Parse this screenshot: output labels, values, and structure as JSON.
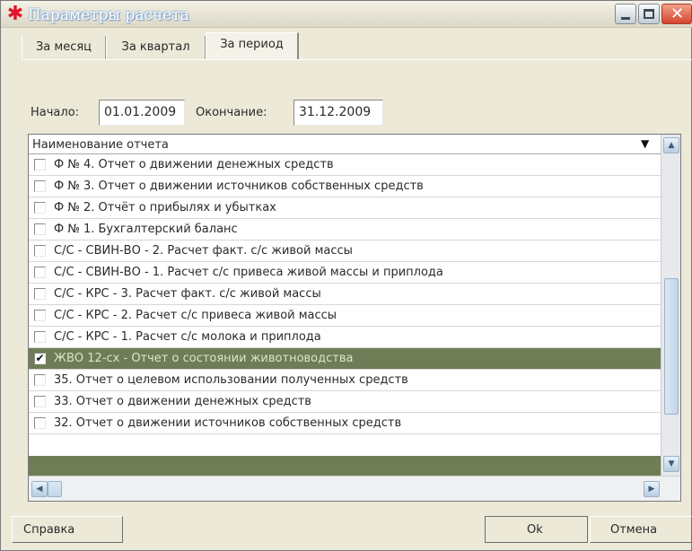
{
  "window": {
    "title": "Параметры расчета",
    "icon": "asterisk-icon",
    "colors": {
      "selection": "#6e7d56",
      "close_button": "#d4442e"
    }
  },
  "tabs": [
    {
      "label": "За месяц",
      "active": false
    },
    {
      "label": "За квартал",
      "active": false
    },
    {
      "label": "За период",
      "active": true
    }
  ],
  "period": {
    "start_label": "Начало:",
    "start_value": "01.01.2009",
    "end_label": "Окончание:",
    "end_value": "31.12.2009"
  },
  "report_list": {
    "column_header": "Наименование отчета",
    "header_arrow": "▼",
    "items": [
      {
        "label": "Ф № 4. Отчет о движении денежных средств",
        "checked": false
      },
      {
        "label": "Ф № 3. Отчет о движении источников собственных средств",
        "checked": false
      },
      {
        "label": "Ф № 2. Отчёт о прибылях и убытках",
        "checked": false
      },
      {
        "label": "Ф № 1. Бухгалтерский баланс",
        "checked": false
      },
      {
        "label": "С/С - СВИН-ВО - 2. Расчет факт. с/с живой массы",
        "checked": false
      },
      {
        "label": "С/С - СВИН-ВО - 1. Расчет с/с привеса живой массы и приплода",
        "checked": false
      },
      {
        "label": "С/С - КРС - 3. Расчет факт. с/с живой массы",
        "checked": false
      },
      {
        "label": "С/С - КРС - 2. Расчет с/с привеса живой массы",
        "checked": false
      },
      {
        "label": "С/С - КРС - 1. Расчет с/с молока и приплода",
        "checked": false
      },
      {
        "label": "ЖВО 12-сх - Отчет о состоянии животноводства",
        "checked": true,
        "selected": true
      },
      {
        "label": "35. Отчет о целевом использовании полученных средств",
        "checked": false
      },
      {
        "label": "33. Отчет о движении денежных средств",
        "checked": false
      },
      {
        "label": "32. Отчет о движении источников собственных средств",
        "checked": false
      }
    ]
  },
  "buttons": {
    "help": "Справка",
    "ok": "Ok",
    "cancel": "Отмена"
  }
}
